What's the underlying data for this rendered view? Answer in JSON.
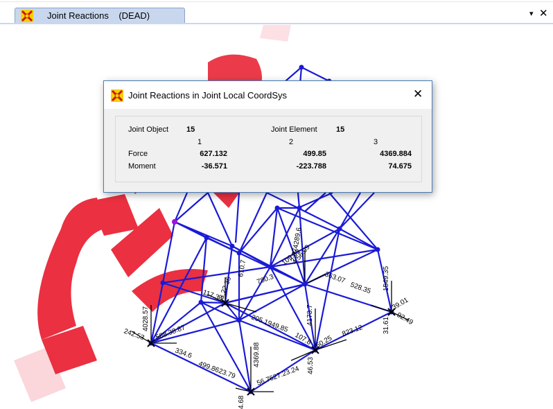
{
  "tab": {
    "title": "Joint Reactions    (DEAD)",
    "dropdown_symbol": "▾",
    "close_symbol": "✕"
  },
  "dialog": {
    "title": "Joint Reactions in Joint Local CoordSys",
    "close_symbol": "✕",
    "joint_object_label": "Joint  Object",
    "joint_object_value": "15",
    "joint_element_label": "Joint Element",
    "joint_element_value": "15",
    "columns": [
      "1",
      "2",
      "3"
    ],
    "rows": [
      {
        "label": "Force",
        "values": [
          "627.132",
          "499.85",
          "4369.884"
        ]
      },
      {
        "label": "Moment",
        "values": [
          "-36.571",
          "-223.788",
          "74.675"
        ]
      }
    ]
  },
  "model_labels": [
    "4028.57",
    "242.53",
    "588.38.87",
    "334.6",
    "499.8623.79",
    "4369.88",
    "56.7627.23.24",
    "4.68",
    "117.34",
    "3.22.36",
    "610.7",
    "780.3",
    "205.1949.85",
    "107.8",
    "60.25",
    "46.53",
    "4173.7",
    "823.12",
    "31.61",
    "39.01",
    "92.49",
    "1549.35",
    "363.07",
    "528.35",
    "109.39",
    "4.56.09",
    "2.974289.6"
  ],
  "colors": {
    "members": "#1a1ad6",
    "selected_node": "#a010e0",
    "watermark": "#e8192c",
    "tab_bg": "#c9d7ee"
  },
  "icons": {
    "tab_icon": "sap-logo-icon",
    "dialog_icon": "sap-logo-icon"
  }
}
